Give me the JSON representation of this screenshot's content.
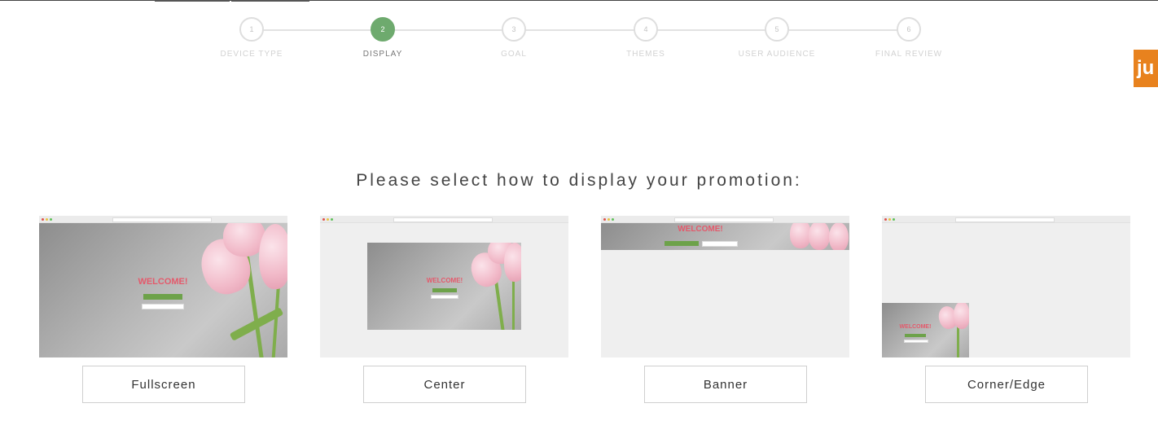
{
  "stepper": {
    "steps": [
      {
        "number": "1",
        "label": "DEVICE TYPE"
      },
      {
        "number": "2",
        "label": "DISPLAY"
      },
      {
        "number": "3",
        "label": "GOAL"
      },
      {
        "number": "4",
        "label": "THEMES"
      },
      {
        "number": "5",
        "label": "USER AUDIENCE"
      },
      {
        "number": "6",
        "label": "FINAL REVIEW"
      }
    ],
    "active_index": 1
  },
  "side_tab": {
    "text": "ju"
  },
  "prompt": "Please select how to display your promotion:",
  "options": [
    {
      "label": "Fullscreen",
      "preview_text": "WELCOME!"
    },
    {
      "label": "Center",
      "preview_text": "WELCOME!"
    },
    {
      "label": "Banner",
      "preview_text": "WELCOME!"
    },
    {
      "label": "Corner/Edge",
      "preview_text": "WELCOME!"
    }
  ],
  "colors": {
    "active_step": "#6eaa6e",
    "side_tab": "#e8821e",
    "welcome_text": "#e45a6c",
    "cta_green": "#6da24a"
  }
}
